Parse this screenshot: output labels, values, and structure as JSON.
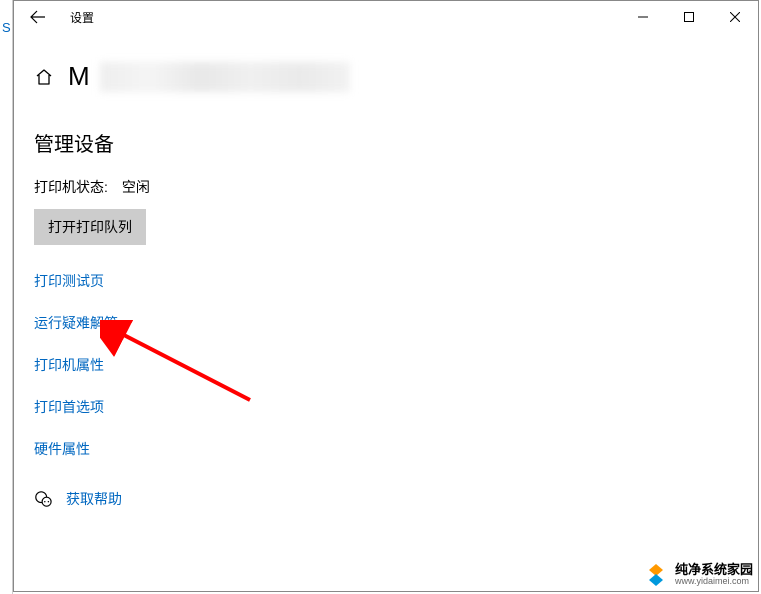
{
  "edge_marker": "S",
  "titlebar": {
    "title": "设置"
  },
  "header": {
    "title_prefix": "M"
  },
  "section": {
    "heading": "管理设备",
    "status_label": "打印机状态:",
    "status_value": "空闲",
    "open_queue_button": "打开打印队列"
  },
  "links": {
    "print_test": "打印测试页",
    "troubleshoot": "运行疑难解答",
    "printer_properties": "打印机属性",
    "print_preferences": "打印首选项",
    "hardware_properties": "硬件属性"
  },
  "help": {
    "label": "获取帮助"
  },
  "watermark": {
    "main": "纯净系统家园",
    "sub": "www.yidaimei.com"
  }
}
